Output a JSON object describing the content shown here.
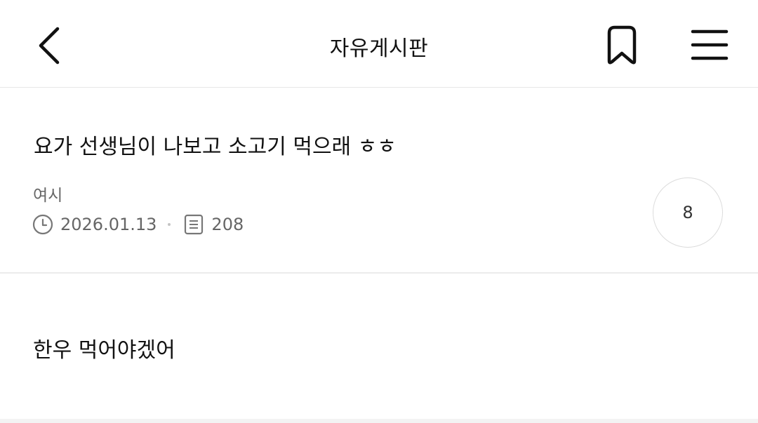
{
  "header": {
    "title": "자유게시판",
    "back_icon": "chevron-left-icon",
    "bookmark_icon": "bookmark-icon",
    "menu_icon": "hamburger-menu-icon"
  },
  "post": {
    "title": "요가 선생님이 나보고 소고기 먹으래 ㅎㅎ",
    "author": "여시",
    "date": "2026.01.13",
    "views": "208",
    "comment_count": "8",
    "body": "한우 먹어야겠어"
  },
  "colors": {
    "text_primary": "#111111",
    "text_secondary": "#666666",
    "divider": "#e6e6e6"
  }
}
